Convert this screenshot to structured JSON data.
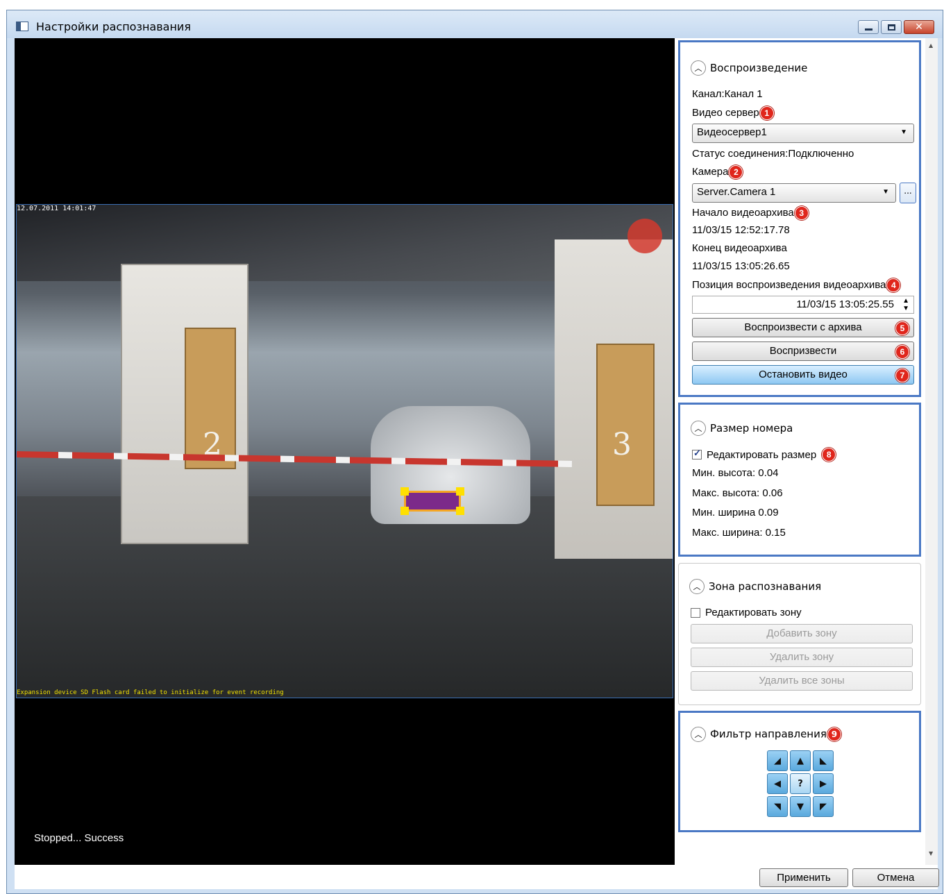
{
  "window": {
    "title": "Настройки распознавания"
  },
  "video": {
    "status": "Stopped... Success",
    "osd_top_left": "12.07.2011 14:01:47",
    "osd_bottom": "Expansion device SD Flash card failed to initialize for event recording",
    "booth_left_number": "2",
    "booth_right_number": "3"
  },
  "playback": {
    "header": "Воспроизведение",
    "channel": "Канал:Канал 1",
    "server_label": "Видео сервер",
    "server_badge": "1",
    "server_value": "Видеосервер1",
    "connection_status": "Статус соединения:Подключенно",
    "camera_label": "Камера",
    "camera_badge": "2",
    "camera_value": "Server.Camera 1",
    "browse_label": "...",
    "archive_start_label": "Начало видеоархива",
    "archive_start_badge": "3",
    "archive_start_value": "11/03/15 12:52:17.78",
    "archive_end_label": "Конец видеоархива",
    "archive_end_value": "11/03/15 13:05:26.65",
    "position_label": "Позиция воспроизведения видеоархива",
    "position_badge": "4",
    "position_value": "11/03/15 13:05:25.55",
    "btn_play_archive": "Воспроизвести с архива",
    "btn_play_archive_badge": "5",
    "btn_play": "Воспризвести",
    "btn_play_badge": "6",
    "btn_stop": "Остановить видео",
    "btn_stop_badge": "7"
  },
  "plate_size": {
    "header": "Размер номера",
    "edit_label": "Редактировать размер",
    "edit_checked": true,
    "edit_badge": "8",
    "min_height": "Мин. высота: 0.04",
    "max_height": "Макс. высота: 0.06",
    "min_width": "Мин. ширина 0.09",
    "max_width": "Макс. ширина: 0.15"
  },
  "zone": {
    "header": "Зона распознавания",
    "edit_label": "Редактировать зону",
    "edit_checked": false,
    "btn_add": "Добавить зону",
    "btn_delete": "Удалить зону",
    "btn_delete_all": "Удалить все зоны"
  },
  "direction": {
    "header": "Фильтр направления",
    "badge": "9",
    "center": "?"
  },
  "footer": {
    "apply": "Применить",
    "cancel": "Отмена"
  },
  "colors": {
    "highlight": "#4a78c4",
    "badge": "#e0261c",
    "active_button": "#8ec8f2"
  }
}
